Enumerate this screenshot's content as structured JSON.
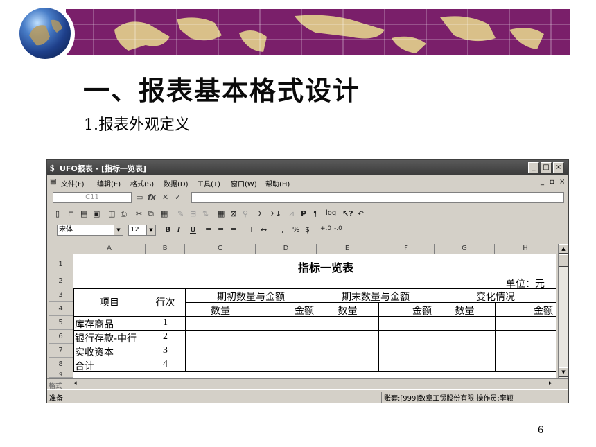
{
  "slide": {
    "title": "一、报表基本格式设计",
    "subtitle": "1.报表外观定义",
    "page_number": "6"
  },
  "window": {
    "title": "UFO报表 - [指标一览表]",
    "menu": [
      "文件(F)",
      "编辑(E)",
      "格式(S)",
      "数据(D)",
      "工具(T)",
      "窗口(W)",
      "帮助(H)"
    ],
    "mdi_controls": [
      "_",
      "▫",
      "×"
    ],
    "cell_ref": "C11",
    "font_name": "宋体",
    "font_size": "12",
    "columns": [
      "A",
      "B",
      "C",
      "D",
      "E",
      "F",
      "G",
      "H"
    ],
    "rows": [
      "1",
      "2",
      "3",
      "4",
      "5",
      "6",
      "7",
      "8",
      "9"
    ],
    "sheet": {
      "table_title": "指标一览表",
      "unit": "单位：元",
      "header_item": "项目",
      "header_line": "行次",
      "group_opening": "期初数量与金额",
      "group_closing": "期末数量与金额",
      "group_change": "变化情况",
      "sub_qty": "数量",
      "sub_amount": "金额",
      "items": [
        {
          "name": "库存商品",
          "line": "1"
        },
        {
          "name": "银行存款-中行",
          "line": "2"
        },
        {
          "name": "实收资本",
          "line": "3"
        },
        {
          "name": "合计",
          "line": "4"
        }
      ]
    },
    "mode_label": "格式",
    "status_left": "准备",
    "status_right": "账套:[999]致章工贸股份有限 操作员:李颖"
  },
  "colors": {
    "banner": "#7a1f6a",
    "map_land": "#d9c089"
  }
}
